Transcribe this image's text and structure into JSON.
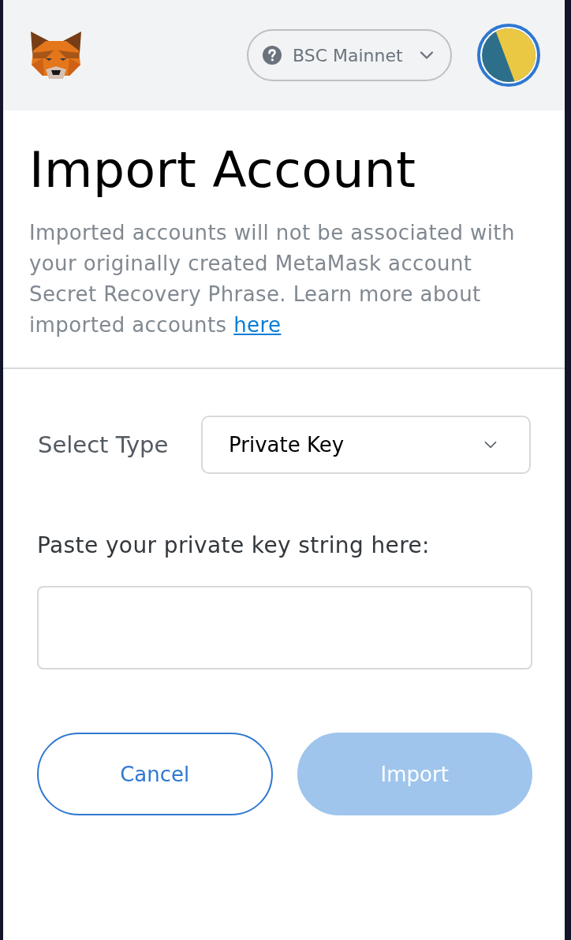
{
  "header": {
    "network": {
      "label": "BSC Mainnet"
    }
  },
  "page": {
    "title": "Import Account",
    "description": "Imported accounts will not be associated with your originally created MetaMask account Secret Recovery Phrase. Learn more about imported accounts",
    "link": "here"
  },
  "select_type": {
    "label": "Select Type",
    "value": "Private Key"
  },
  "private_key": {
    "label": "Paste your private key string here:"
  },
  "buttons": [
    {
      "label": "Cancel",
      "kind": "secondary",
      "disabled": false
    },
    {
      "label": "Import",
      "kind": "primary",
      "disabled": true
    }
  ]
}
